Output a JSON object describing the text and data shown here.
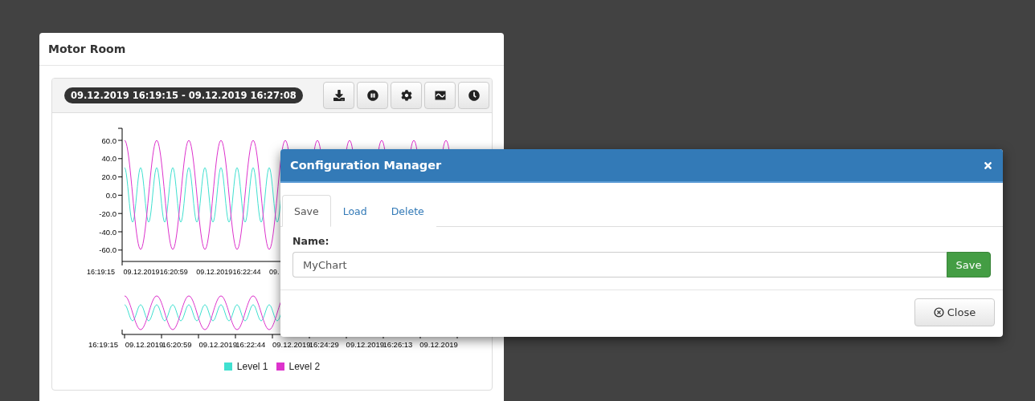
{
  "panel": {
    "title": "Motor Room"
  },
  "chart": {
    "range": "09.12.2019 16:19:15 - 09.12.2019 16:27:08",
    "toolbar": [
      {
        "kind": "download"
      },
      {
        "kind": "pause"
      },
      {
        "kind": "settings"
      },
      {
        "kind": "wave"
      },
      {
        "kind": "clock"
      }
    ],
    "y_ticks": [
      "60.0",
      "40.0",
      "20.0",
      "0.0",
      "-20.0",
      "-40.0",
      "-60.0"
    ],
    "x_ticks": [
      "16:19:15",
      "09.12.2019",
      "16:20:59",
      "09.12.2019",
      "16:22:44",
      "09."
    ],
    "overview_x_ticks": [
      "16:19:15",
      "09.12.2019",
      "16:20:59",
      "09.12.2019",
      "16:22:44",
      "09.12.2019",
      "16:24:29",
      "09.12.2019",
      "16:26:13",
      "09.12.2019"
    ],
    "legend": [
      {
        "label": "Level 1",
        "color": "#40e0d0"
      },
      {
        "label": "Level 2",
        "color": "#dd33cc"
      }
    ]
  },
  "dialog": {
    "title": "Configuration Manager",
    "tabs": [
      {
        "label": "Save",
        "selected": true
      },
      {
        "label": "Load",
        "selected": false
      },
      {
        "label": "Delete",
        "selected": false
      }
    ],
    "field_label": "Name:",
    "value": "MyChart",
    "save": "Save",
    "close": "Close"
  }
}
